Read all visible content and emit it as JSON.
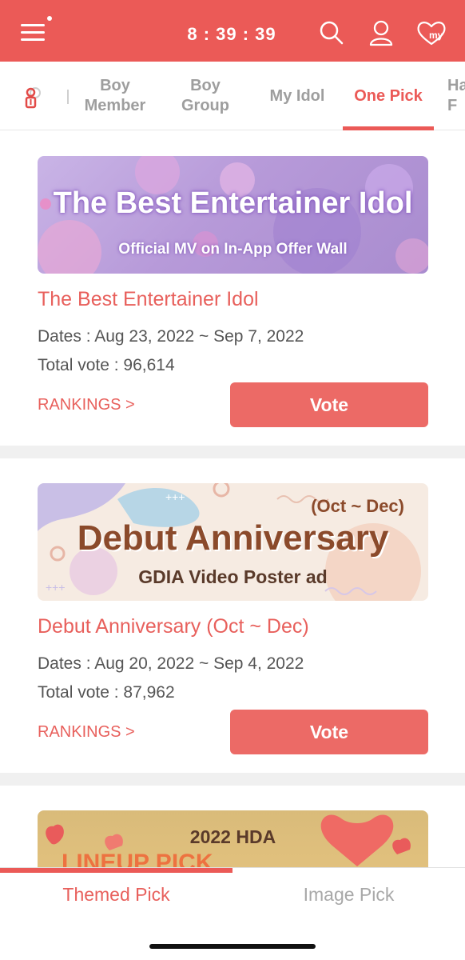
{
  "header": {
    "clock": "8 : 39 : 39",
    "icons": [
      "menu-icon",
      "search-icon",
      "profile-icon",
      "heart-my-icon"
    ],
    "my_label": "my",
    "colors": {
      "brand": "#eb5a57"
    }
  },
  "tabs": {
    "items": [
      {
        "label": "Boy\nMember"
      },
      {
        "label": "Boy\nGroup"
      },
      {
        "label": "My Idol"
      },
      {
        "label": "One Pick",
        "active": true
      },
      {
        "label": "Ha\nF"
      }
    ]
  },
  "cards": [
    {
      "banner_title": "The Best Entertainer Idol",
      "banner_subtitle": "Official MV on In-App Offer Wall",
      "title": "The Best Entertainer Idol",
      "dates": "Dates : Aug 23, 2022 ~ Sep 7, 2022",
      "total_vote": "Total vote : 96,614",
      "rankings": "RANKINGS >",
      "vote": "Vote"
    },
    {
      "banner_top": "(Oct ~ Dec)",
      "banner_title": "Debut Anniversary",
      "banner_subtitle": "GDIA Video Poster ad",
      "title": "Debut Anniversary (Oct ~ Dec)",
      "dates": "Dates : Aug 20, 2022 ~ Sep 4, 2022",
      "total_vote": "Total vote : 87,962",
      "rankings": "RANKINGS >",
      "vote": "Vote"
    },
    {
      "banner_title": "2022 HDA"
    }
  ],
  "bottom_nav": {
    "tabs": [
      {
        "label": "Themed Pick",
        "active": true
      },
      {
        "label": "Image Pick"
      }
    ]
  }
}
